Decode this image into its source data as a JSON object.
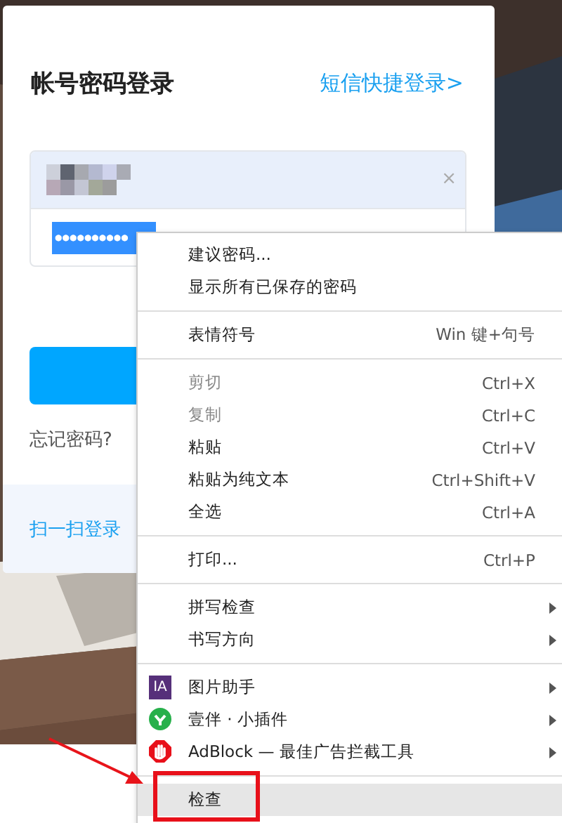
{
  "login_card": {
    "title": "帐号密码登录",
    "sms_link": "短信快捷登录>",
    "username_clear": "×",
    "password_value": "●●●●●●●●●●",
    "forgot_link": "忘记密码?",
    "scan_link": "扫一扫登录"
  },
  "context_menu": {
    "items": [
      {
        "kind": "item",
        "label": "建议密码...",
        "disabled": false,
        "submenu": false,
        "highlighted": false
      },
      {
        "kind": "item",
        "label": "显示所有已保存的密码",
        "disabled": false,
        "submenu": false,
        "highlighted": false
      },
      {
        "kind": "separator"
      },
      {
        "kind": "item",
        "label": "表情符号",
        "shortcut": "Win 键+句号",
        "disabled": false,
        "submenu": false,
        "highlighted": false
      },
      {
        "kind": "separator"
      },
      {
        "kind": "item",
        "label": "剪切",
        "shortcut": "Ctrl+X",
        "disabled": true,
        "submenu": false,
        "highlighted": false
      },
      {
        "kind": "item",
        "label": "复制",
        "shortcut": "Ctrl+C",
        "disabled": true,
        "submenu": false,
        "highlighted": false
      },
      {
        "kind": "item",
        "label": "粘贴",
        "shortcut": "Ctrl+V",
        "disabled": false,
        "submenu": false,
        "highlighted": false
      },
      {
        "kind": "item",
        "label": "粘贴为纯文本",
        "shortcut": "Ctrl+Shift+V",
        "disabled": false,
        "submenu": false,
        "highlighted": false
      },
      {
        "kind": "item",
        "label": "全选",
        "shortcut": "Ctrl+A",
        "disabled": false,
        "submenu": false,
        "highlighted": false
      },
      {
        "kind": "separator"
      },
      {
        "kind": "item",
        "label": "打印...",
        "shortcut": "Ctrl+P",
        "disabled": false,
        "submenu": false,
        "highlighted": false
      },
      {
        "kind": "separator"
      },
      {
        "kind": "item",
        "label": "拼写检查",
        "disabled": false,
        "submenu": true,
        "highlighted": false
      },
      {
        "kind": "item",
        "label": "书写方向",
        "disabled": false,
        "submenu": true,
        "highlighted": false
      },
      {
        "kind": "separator"
      },
      {
        "kind": "item",
        "label": "图片助手",
        "icon_text": "IA",
        "disabled": false,
        "submenu": true,
        "highlighted": false
      },
      {
        "kind": "item",
        "label": "壹伴 · 小插件",
        "disabled": false,
        "submenu": true,
        "highlighted": false
      },
      {
        "kind": "item",
        "label": "AdBlock — 最佳广告拦截工具",
        "disabled": false,
        "submenu": true,
        "highlighted": false
      },
      {
        "kind": "separator"
      },
      {
        "kind": "item",
        "label": "检查",
        "disabled": false,
        "submenu": false,
        "highlighted": true
      }
    ]
  }
}
